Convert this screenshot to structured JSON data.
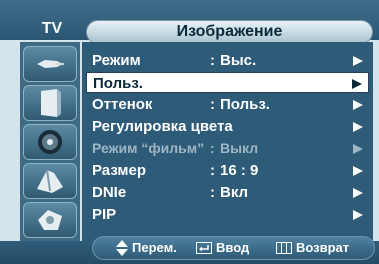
{
  "header": {
    "tv_label": "TV",
    "title": "Изображение"
  },
  "sidebar": {
    "icons": [
      "input-icon",
      "picture-icon",
      "sound-icon",
      "channel-icon",
      "setup-icon"
    ]
  },
  "menu": {
    "items": [
      {
        "label": "Режим",
        "colon": ":",
        "value": "Выс.",
        "selected": false,
        "disabled": false
      },
      {
        "label": "Польз.",
        "colon": "",
        "value": "",
        "selected": true,
        "disabled": false
      },
      {
        "label": "Оттенок",
        "colon": ":",
        "value": "Польз.",
        "selected": false,
        "disabled": false
      },
      {
        "label": "Регулировка цвета",
        "colon": "",
        "value": "",
        "selected": false,
        "disabled": false
      },
      {
        "label": "Режим “фильм”",
        "colon": ":",
        "value": "Выкл",
        "selected": false,
        "disabled": true
      },
      {
        "label": "Размер",
        "colon": ":",
        "value": "16 : 9",
        "selected": false,
        "disabled": false
      },
      {
        "label": "DNIe",
        "colon": ":",
        "value": "Вкл",
        "selected": false,
        "disabled": false
      },
      {
        "label": "PIP",
        "colon": "",
        "value": "",
        "selected": false,
        "disabled": false
      }
    ]
  },
  "footer": {
    "move_label": "Перем.",
    "enter_label": "Ввод",
    "return_label": "Возврат"
  },
  "colors": {
    "panel": "#2e5b78",
    "frame": "#d4e4ea",
    "highlight": "#ffffff",
    "disabled_text": "#9fb6c4"
  }
}
